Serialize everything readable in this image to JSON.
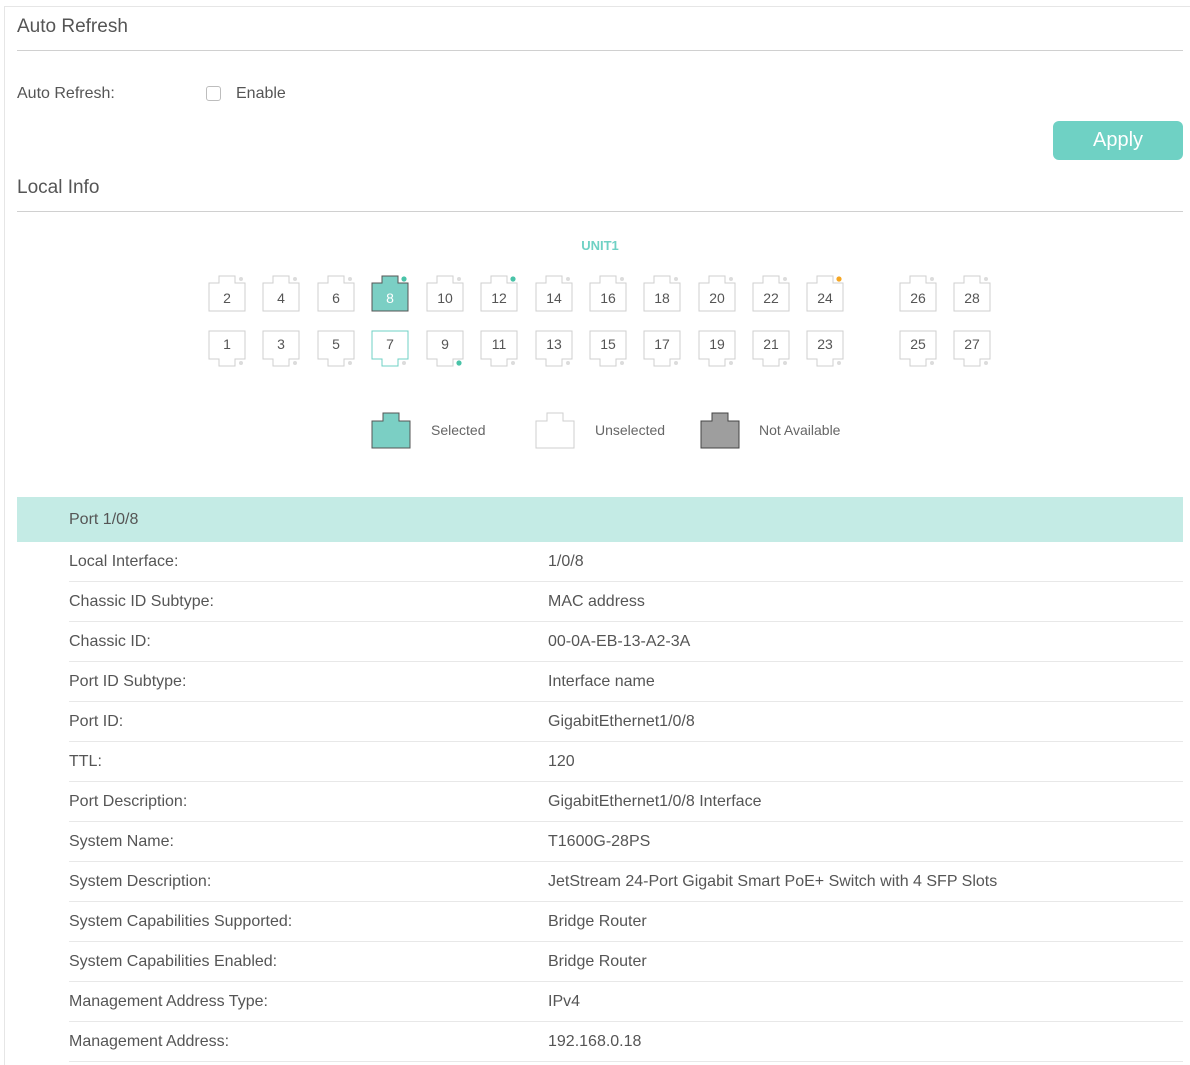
{
  "auto_refresh": {
    "section_title": "Auto Refresh",
    "field_label": "Auto Refresh:",
    "checkbox_label": "Enable",
    "checked": false
  },
  "apply_label": "Apply",
  "local_info": {
    "section_title": "Local Info",
    "unit_label": "UNIT1",
    "top_ports": [
      {
        "num": "2",
        "state": "unselected",
        "led": ""
      },
      {
        "num": "4",
        "state": "unselected",
        "led": ""
      },
      {
        "num": "6",
        "state": "unselected",
        "led": ""
      },
      {
        "num": "8",
        "state": "selected",
        "led": "green"
      },
      {
        "num": "10",
        "state": "unselected",
        "led": ""
      },
      {
        "num": "12",
        "state": "unselected",
        "led": "green"
      },
      {
        "num": "14",
        "state": "unselected",
        "led": ""
      },
      {
        "num": "16",
        "state": "unselected",
        "led": ""
      },
      {
        "num": "18",
        "state": "unselected",
        "led": ""
      },
      {
        "num": "20",
        "state": "unselected",
        "led": ""
      },
      {
        "num": "22",
        "state": "unselected",
        "led": ""
      },
      {
        "num": "24",
        "state": "unselected",
        "led": "orange"
      },
      {
        "num": "26",
        "state": "unselected",
        "led": ""
      },
      {
        "num": "28",
        "state": "unselected",
        "led": ""
      }
    ],
    "bottom_ports": [
      {
        "num": "1",
        "state": "unselected",
        "led": ""
      },
      {
        "num": "3",
        "state": "unselected",
        "led": ""
      },
      {
        "num": "5",
        "state": "unselected",
        "led": ""
      },
      {
        "num": "7",
        "state": "hover",
        "led": ""
      },
      {
        "num": "9",
        "state": "unselected",
        "led": "green"
      },
      {
        "num": "11",
        "state": "unselected",
        "led": ""
      },
      {
        "num": "13",
        "state": "unselected",
        "led": ""
      },
      {
        "num": "15",
        "state": "unselected",
        "led": ""
      },
      {
        "num": "17",
        "state": "unselected",
        "led": ""
      },
      {
        "num": "19",
        "state": "unselected",
        "led": ""
      },
      {
        "num": "21",
        "state": "unselected",
        "led": ""
      },
      {
        "num": "23",
        "state": "unselected",
        "led": ""
      },
      {
        "num": "25",
        "state": "unselected",
        "led": ""
      },
      {
        "num": "27",
        "state": "unselected",
        "led": ""
      }
    ],
    "legend": {
      "selected": "Selected",
      "unselected": "Unselected",
      "not_available": "Not Available"
    }
  },
  "colors": {
    "accent": "#6fd1c4",
    "selected_fill": "#7bcfc4",
    "header_bg": "#c4ebe5",
    "not_available_fill": "#9e9e9e",
    "led_green": "#49c3a8",
    "led_orange": "#f5a623"
  },
  "port_detail": {
    "header": "Port 1/0/8",
    "rows": [
      {
        "label": "Local Interface:",
        "value": "1/0/8"
      },
      {
        "label": "Chassic ID Subtype:",
        "value": "MAC address"
      },
      {
        "label": "Chassic ID:",
        "value": "00-0A-EB-13-A2-3A"
      },
      {
        "label": "Port ID Subtype:",
        "value": "Interface name"
      },
      {
        "label": "Port ID:",
        "value": "GigabitEthernet1/0/8"
      },
      {
        "label": "TTL:",
        "value": "120"
      },
      {
        "label": "Port Description:",
        "value": "GigabitEthernet1/0/8 Interface"
      },
      {
        "label": "System Name:",
        "value": "T1600G-28PS"
      },
      {
        "label": "System Description:",
        "value": "JetStream 24-Port Gigabit Smart PoE+ Switch with 4 SFP Slots"
      },
      {
        "label": "System Capabilities Supported:",
        "value": "Bridge Router"
      },
      {
        "label": "System Capabilities Enabled:",
        "value": "Bridge Router"
      },
      {
        "label": "Management Address Type:",
        "value": "IPv4"
      },
      {
        "label": "Management Address:",
        "value": "192.168.0.18"
      }
    ]
  }
}
